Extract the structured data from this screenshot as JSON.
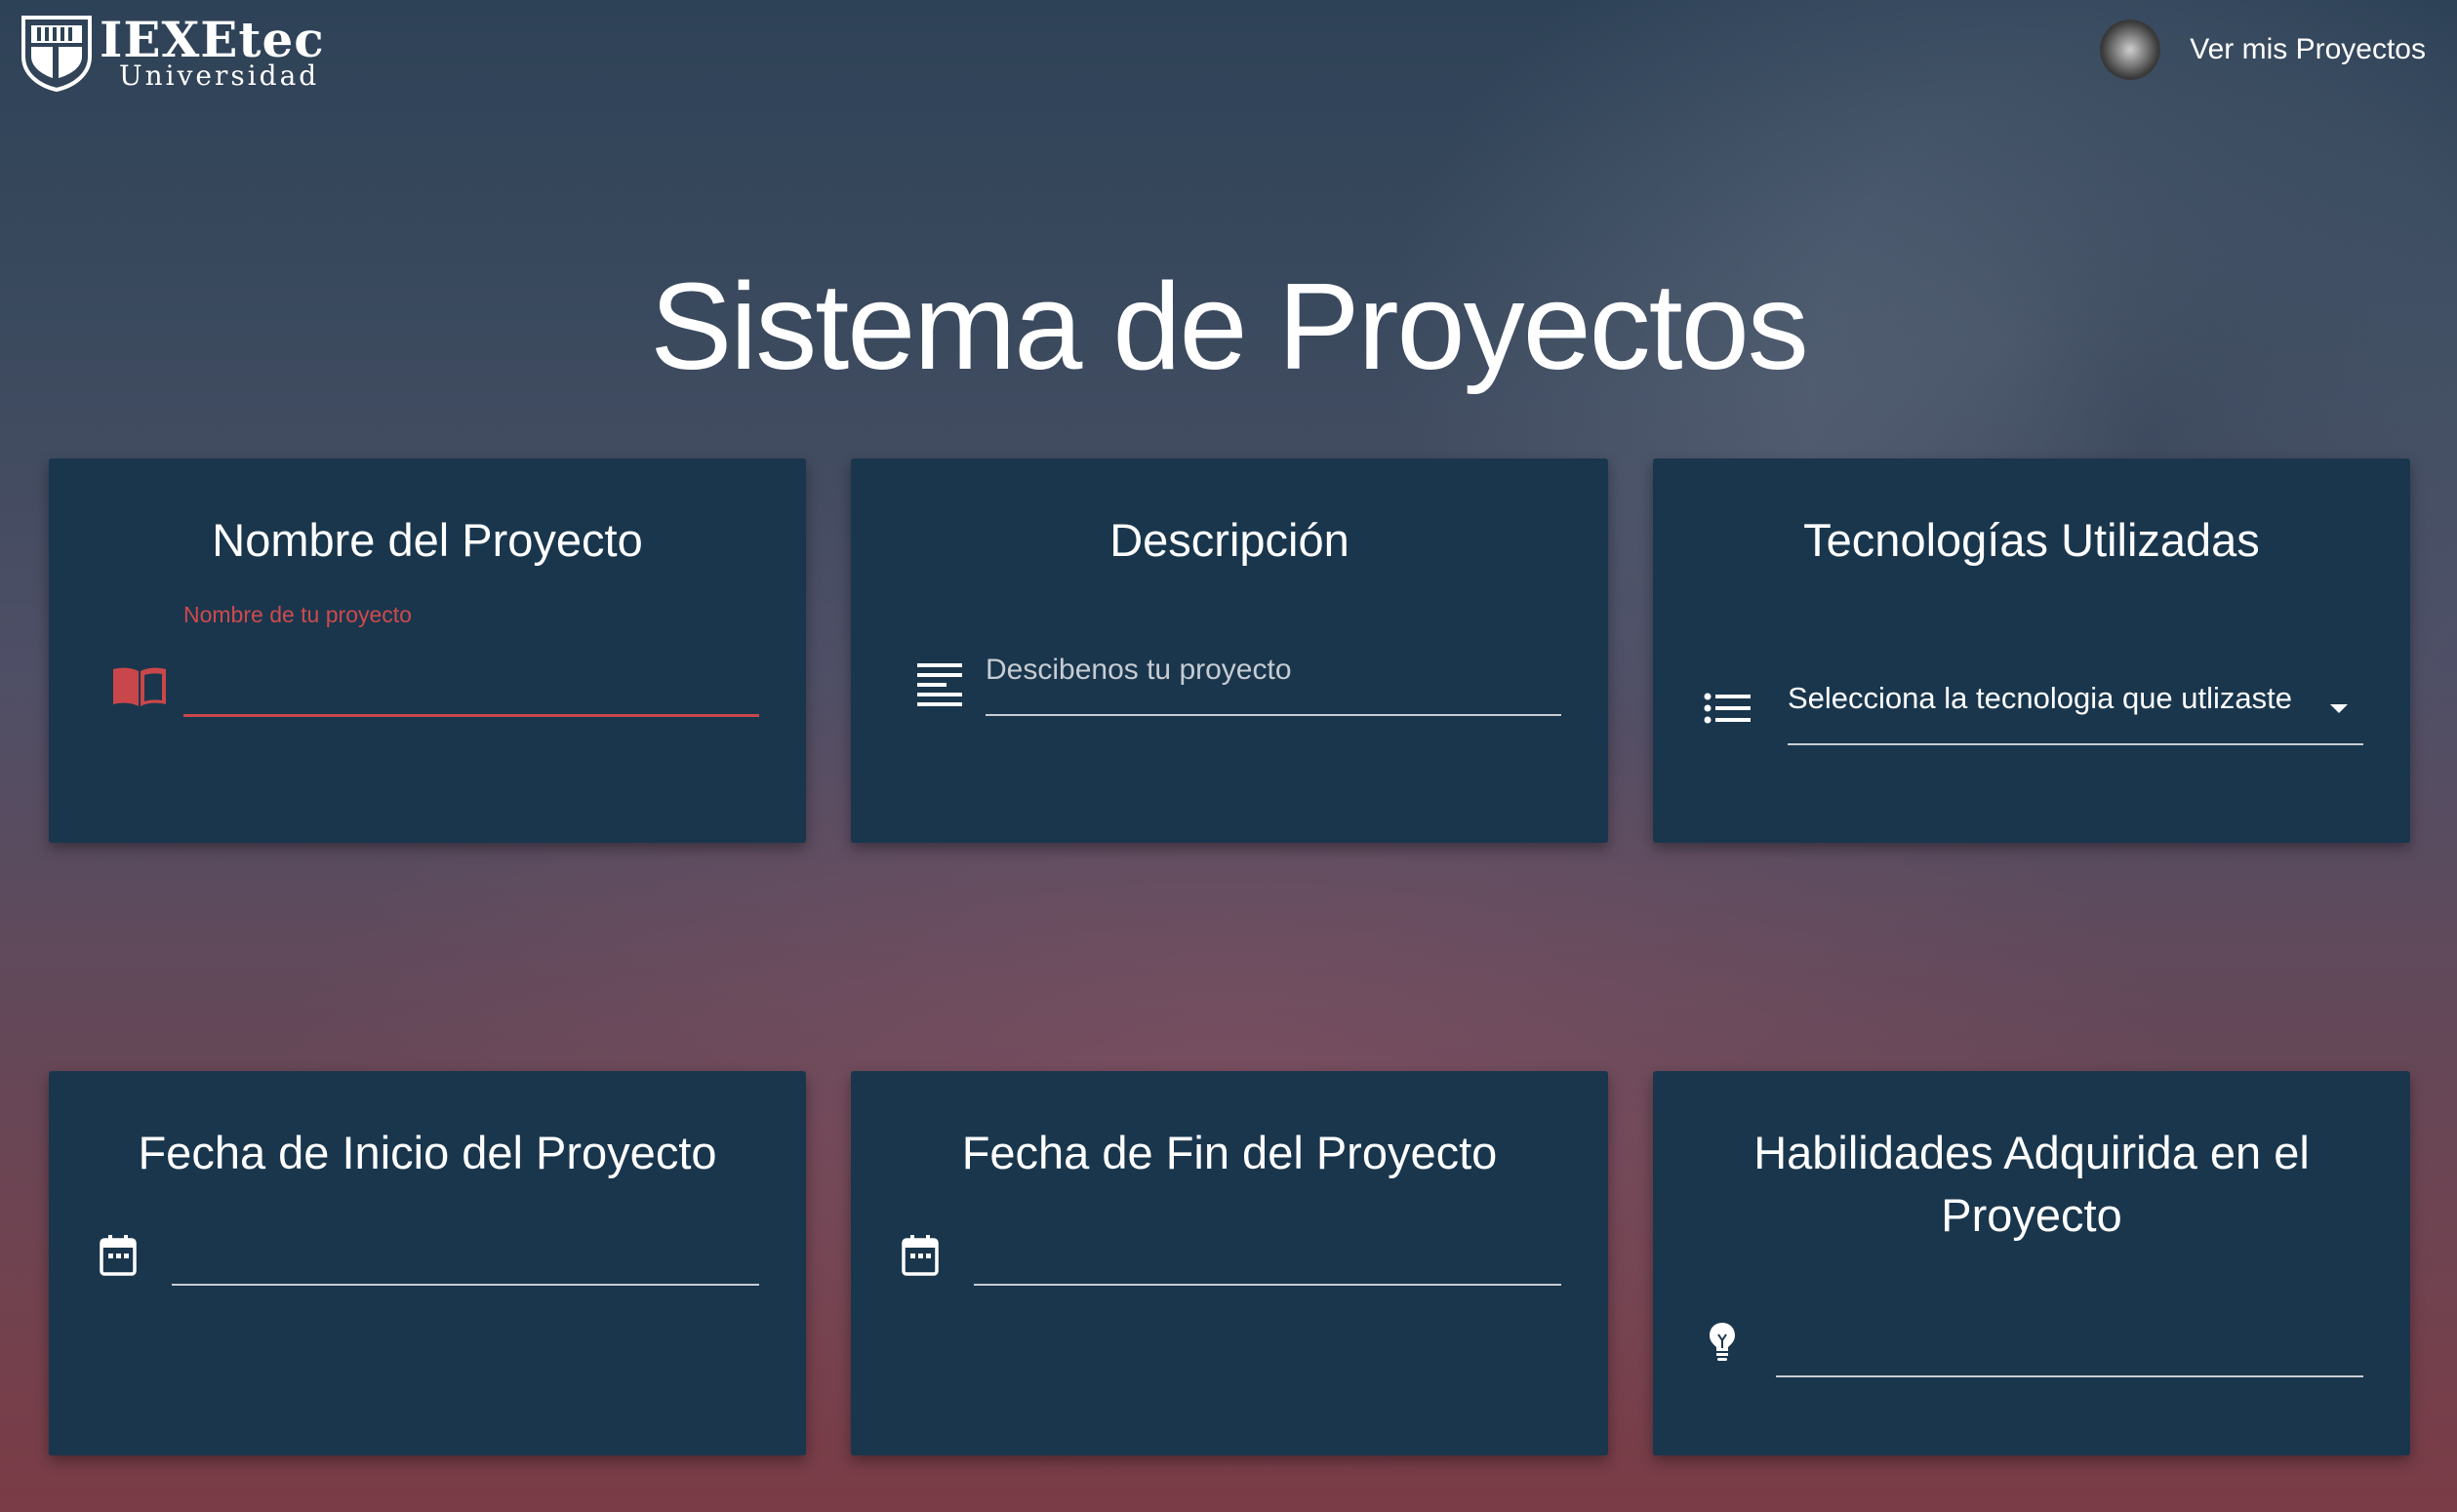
{
  "header": {
    "brand": "IEXEtec",
    "subtitle": "Universidad",
    "nav_link": "Ver mis Proyectos"
  },
  "page_title": "Sistema de Proyectos",
  "cards": {
    "name": {
      "title": "Nombre del Proyecto",
      "label": "Nombre de tu proyecto",
      "value": "",
      "icon": "book-icon"
    },
    "description": {
      "title": "Descripción",
      "placeholder": "Descibenos tu proyecto",
      "icon": "text-lines-icon"
    },
    "technologies": {
      "title": "Tecnologías Utilizadas",
      "selected": "Selecciona la tecnologia que utlizaste",
      "icon": "list-icon"
    },
    "start_date": {
      "title": "Fecha de Inicio del Proyecto",
      "value": "",
      "icon": "calendar-icon"
    },
    "end_date": {
      "title": "Fecha de Fin del Proyecto",
      "value": "",
      "icon": "calendar-icon"
    },
    "skills": {
      "title": "Habilidades Adquirida en el Proyecto",
      "value": "",
      "icon": "lightbulb-icon"
    }
  },
  "colors": {
    "card_bg": "#19364d",
    "accent_red": "#c9474a",
    "text": "#ffffff"
  }
}
